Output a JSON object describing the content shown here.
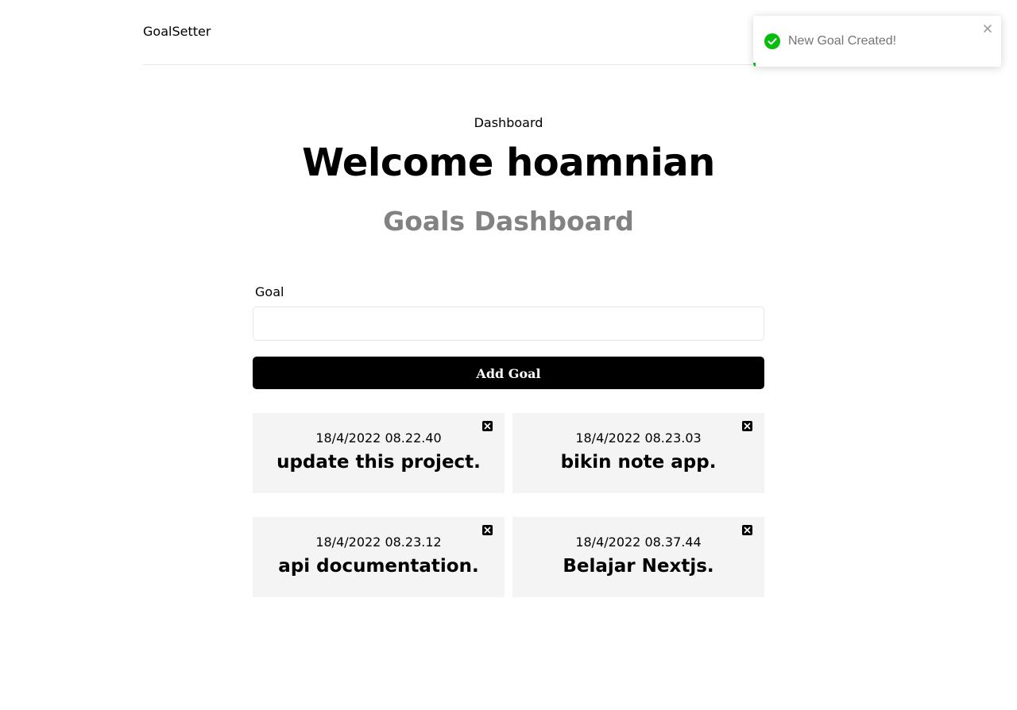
{
  "header": {
    "brand": "GoalSetter"
  },
  "dashboard": {
    "crumb": "Dashboard",
    "welcome": "Welcome hoamnian",
    "subtitle": "Goals Dashboard"
  },
  "form": {
    "label": "Goal",
    "input_value": "",
    "button_label": "Add Goal"
  },
  "goals": [
    {
      "date": "18/4/2022 08.22.40",
      "text": "update this project."
    },
    {
      "date": "18/4/2022 08.23.03",
      "text": "bikin note app."
    },
    {
      "date": "18/4/2022 08.23.12",
      "text": "api documentation."
    },
    {
      "date": "18/4/2022 08.37.44",
      "text": "Belajar Nextjs."
    }
  ],
  "toast": {
    "message": "New Goal Created!",
    "type": "success",
    "progress": 0.01,
    "color": "#07bc0c"
  },
  "colors": {
    "card_bg": "#f4f4f4",
    "button_bg": "#000000",
    "subtitle": "#828282"
  }
}
